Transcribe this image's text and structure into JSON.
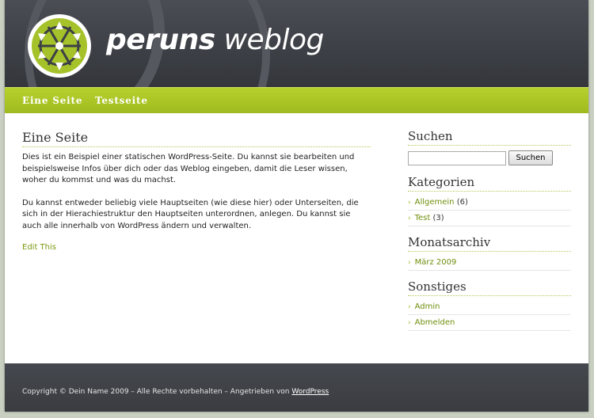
{
  "site": {
    "title_bold": "peruns",
    "title_light": "weblog"
  },
  "nav": {
    "items": [
      {
        "label": "Eine Seite"
      },
      {
        "label": "Testseite"
      }
    ]
  },
  "post": {
    "title": "Eine Seite",
    "paragraph1": "Dies ist ein Beispiel einer statischen WordPress-Seite. Du kannst sie bearbeiten und beispielsweise Infos über dich oder das Weblog eingeben, damit die Leser wissen, woher du kommst und was du machst.",
    "paragraph2": "Du kannst entweder beliebig viele Hauptseiten (wie diese hier) oder Unterseiten, die sich in der Hierachiestruktur den Hauptseiten unterordnen, anlegen. Du kannst sie auch alle innerhalb von WordPress ändern und verwalten.",
    "edit_link": "Edit This"
  },
  "sidebar": {
    "search": {
      "heading": "Suchen",
      "value": "",
      "button": "Suchen"
    },
    "categories": {
      "heading": "Kategorien",
      "items": [
        {
          "label": "Allgemein",
          "count": "(6)"
        },
        {
          "label": "Test",
          "count": "(3)"
        }
      ]
    },
    "archive": {
      "heading": "Monatsarchiv",
      "items": [
        {
          "label": "März 2009"
        }
      ]
    },
    "misc": {
      "heading": "Sonstiges",
      "items": [
        {
          "label": "Admin"
        },
        {
          "label": "Abmelden"
        }
      ]
    }
  },
  "footer": {
    "copyright": "Copyright © Dein Name 2009 – Alle Rechte vorbehalten – Angetrieben von",
    "powered_link": "WordPress"
  },
  "colors": {
    "accent": "#9fba1f",
    "header_bg": "#3c3f45",
    "link": "#6f8f0c"
  }
}
